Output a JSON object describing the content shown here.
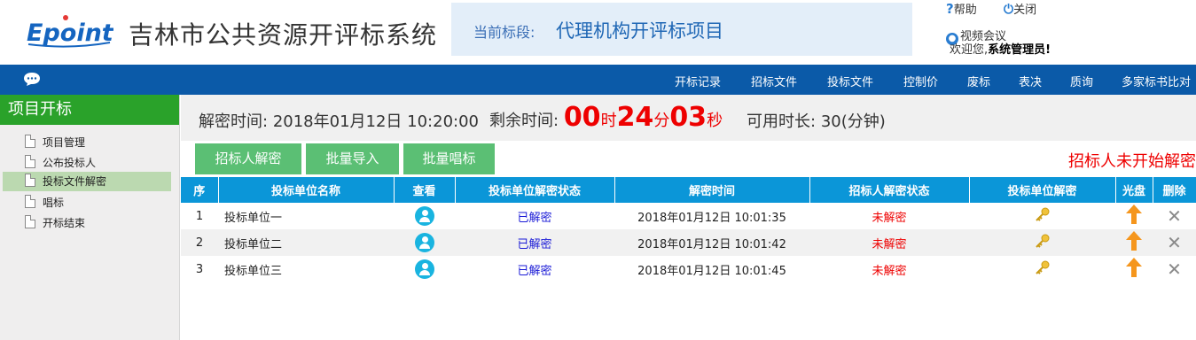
{
  "header": {
    "logo_text": "Epoint",
    "system_title": "吉林市公共资源开评标系统",
    "stage_label": "当前标段:",
    "stage_value": "代理机构开评标项目",
    "help_label": "帮助",
    "close_label": "关闭",
    "video_label": "视频会议",
    "welcome_prefix": "欢迎您,",
    "welcome_user": "系统管理员!"
  },
  "nav": {
    "items": [
      "开标记录",
      "招标文件",
      "投标文件",
      "控制价",
      "废标",
      "表决",
      "质询",
      "多家标书比对"
    ]
  },
  "sidebar": {
    "title": "项目开标",
    "items": [
      {
        "label": "项目管理",
        "active": false
      },
      {
        "label": "公布投标人",
        "active": false
      },
      {
        "label": "投标文件解密",
        "active": true
      },
      {
        "label": "唱标",
        "active": false
      },
      {
        "label": "开标结束",
        "active": false
      }
    ]
  },
  "info": {
    "decrypt_time_label": "解密时间:",
    "decrypt_time_value": "2018年01月12日 10:20:00",
    "remaining_label": "剩余时间:",
    "hours": "00",
    "hours_unit": "时",
    "minutes": "24",
    "minutes_unit": "分",
    "seconds": "03",
    "seconds_unit": "秒",
    "duration_label": "可用时长:",
    "duration_value": "30(分钟)"
  },
  "toolbar": {
    "decrypt_btn": "招标人解密",
    "import_btn": "批量导入",
    "sing_btn": "批量唱标",
    "status_text": "招标人未开始解密"
  },
  "table": {
    "headers": [
      "序",
      "投标单位名称",
      "查看",
      "投标单位解密状态",
      "解密时间",
      "招标人解密状态",
      "投标单位解密",
      "光盘",
      "删除"
    ],
    "rows": [
      {
        "no": "1",
        "name": "投标单位一",
        "bidder_status": "已解密",
        "time": "2018年01月12日 10:01:35",
        "tenderer_status": "未解密"
      },
      {
        "no": "2",
        "name": "投标单位二",
        "bidder_status": "已解密",
        "time": "2018年01月12日 10:01:42",
        "tenderer_status": "未解密"
      },
      {
        "no": "3",
        "name": "投标单位三",
        "bidder_status": "已解密",
        "time": "2018年01月12日 10:01:45",
        "tenderer_status": "未解密"
      }
    ]
  },
  "colors": {
    "nav_bg": "#0b5aa8",
    "sidebar_title_bg": "#2aa22a",
    "button_bg": "#5bbf74",
    "table_header_bg": "#0b96d8",
    "alert_red": "#e00000"
  }
}
